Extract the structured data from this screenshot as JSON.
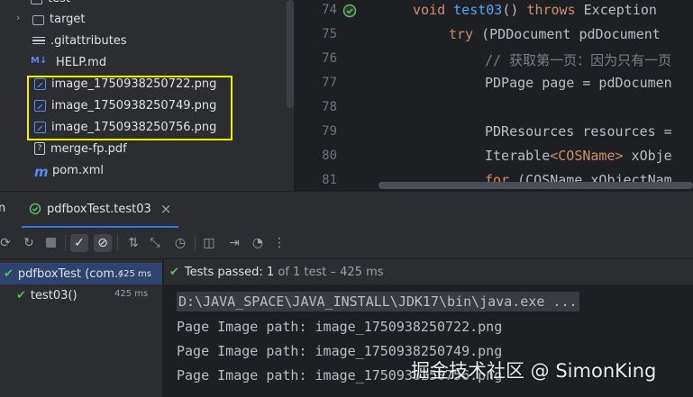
{
  "project_tree": {
    "items": [
      {
        "label": "test",
        "icon": "folder-icon"
      },
      {
        "label": "target",
        "icon": "folder-icon"
      },
      {
        "label": ".gitattributes",
        "icon": "text-file-icon"
      },
      {
        "label": "HELP.md",
        "icon": "markdown-icon",
        "icon_text": "M↓"
      },
      {
        "label": "image_1750938250722.png",
        "icon": "image-file-icon"
      },
      {
        "label": "image_1750938250749.png",
        "icon": "image-file-icon"
      },
      {
        "label": "image_1750938250756.png",
        "icon": "image-file-icon"
      },
      {
        "label": "merge-fp.pdf",
        "icon": "pdf-file-icon"
      },
      {
        "label": "pom.xml",
        "icon": "maven-icon",
        "icon_text": "m"
      }
    ],
    "highlight_color": "#f5f000"
  },
  "editor": {
    "lines": [
      {
        "num": "74"
      },
      {
        "num": "75"
      },
      {
        "num": "76"
      },
      {
        "num": "77"
      },
      {
        "num": "78"
      },
      {
        "num": "79"
      },
      {
        "num": "80"
      },
      {
        "num": "81"
      }
    ],
    "code": {
      "l74": {
        "kw": "void ",
        "fn": "test03",
        "rest": "() ",
        "kw2": "throws ",
        "tail": "Exception"
      },
      "l75": {
        "kw": "try ",
        "tail": "(PDDocument pdDocument"
      },
      "l76": {
        "comment": "// 获取第一页：因为只有一页"
      },
      "l77": {
        "text": "PDPage page = pdDocumen"
      },
      "l79": {
        "text": "PDResources resources ="
      },
      "l80": {
        "pre": "Iterable",
        "generic": "<COSName>",
        "tail": " xObje"
      },
      "l81": {
        "kw": "for ",
        "tail": "(COSName xObjectNam"
      }
    }
  },
  "run_window": {
    "tab_label": "pdfboxTest.test03",
    "tab_close": "×",
    "side_label": "n",
    "toolbar_icons": [
      "rerun-icon",
      "rerun-failed-icon",
      "stop-icon",
      "show-passed-icon",
      "show-ignored-icon",
      "sort-icon",
      "collapse-icon",
      "history-icon",
      "screenshot-icon",
      "import-icon",
      "coverage-icon",
      "more-icon"
    ],
    "tree": {
      "root_label": "pdfboxTest (com.:",
      "root_time": "425 ms",
      "child_label": "test03()",
      "child_time": "425 ms"
    },
    "status": {
      "bold": "Tests passed:",
      "count": " 1 ",
      "rest": "of 1 test – 425 ms"
    },
    "console": {
      "command": "D:\\JAVA_SPACE\\JAVA_INSTALL\\JDK17\\bin\\java.exe ...",
      "lines": [
        "Page Image path: image_1750938250722.png",
        "Page Image path: image_1750938250749.png",
        "Page Image path: image_1750938250756.png"
      ]
    }
  },
  "watermark": "掘金技术社区 @ SimonKing",
  "colors": {
    "accent": "#3574f0",
    "success": "#5fb865",
    "keyword": "#cf8e6d",
    "function": "#56a8f5"
  }
}
